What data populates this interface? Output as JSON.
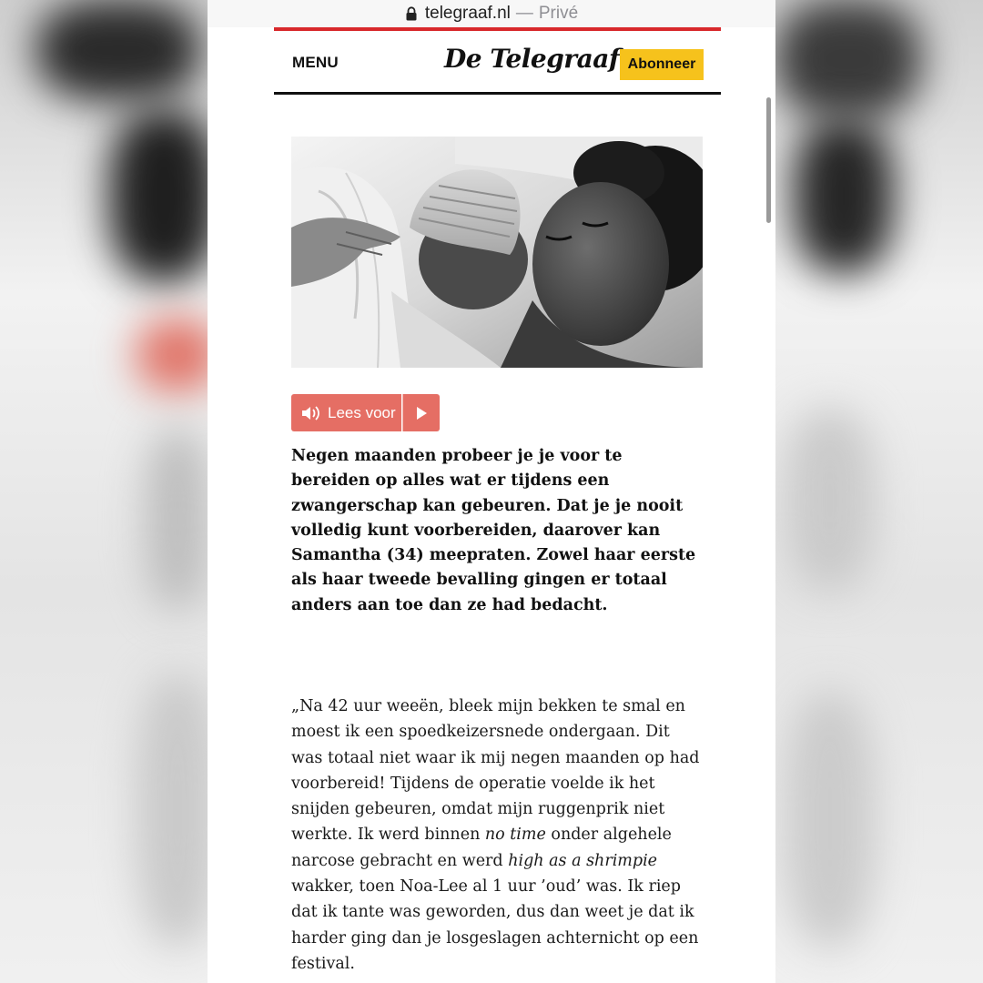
{
  "browser": {
    "domain": "telegraaf.nl",
    "separator": "—",
    "mode": "Privé"
  },
  "header": {
    "menu_label": "MENU",
    "logo_text": "De Telegraaf",
    "subscribe_label": "Abonneer"
  },
  "colors": {
    "accent_red": "#d8282b",
    "subscribe_yellow": "#f6c21c",
    "tts_red": "#e56e64"
  },
  "tts": {
    "read_label": "Lees voor",
    "play_icon": "play-icon",
    "speaker_icon": "speaker-icon"
  },
  "article": {
    "intro": "Negen maanden probeer je je voor te bereiden op alles wat er tijdens een zwangerschap kan gebeuren. Dat je je nooit volledig kunt voorbereiden, daarover kan Samantha (34) meepraten. Zowel haar eerste als haar tweede bevalling gingen er totaal anders aan toe dan ze had bedacht.",
    "body_part1": "„Na 42 uur weeën, bleek mijn bekken te smal en moest ik een spoedkeizersnede ondergaan. Dit was totaal niet waar ik mij negen maanden op had voorbereid! Tijdens de operatie voelde ik het snijden gebeuren, omdat mijn ruggenprik niet werkte. Ik werd binnen ",
    "body_em1": "no time",
    "body_part2": " onder algehele narcose gebracht en werd ",
    "body_em2": "high as a shrimpie",
    "body_part3": " wakker, toen Noa-Lee al 1 uur ’oud’ was. Ik riep dat ik tante was geworden, dus dan weet je dat ik harder ging dan je losgeslagen achternicht op een festival."
  }
}
